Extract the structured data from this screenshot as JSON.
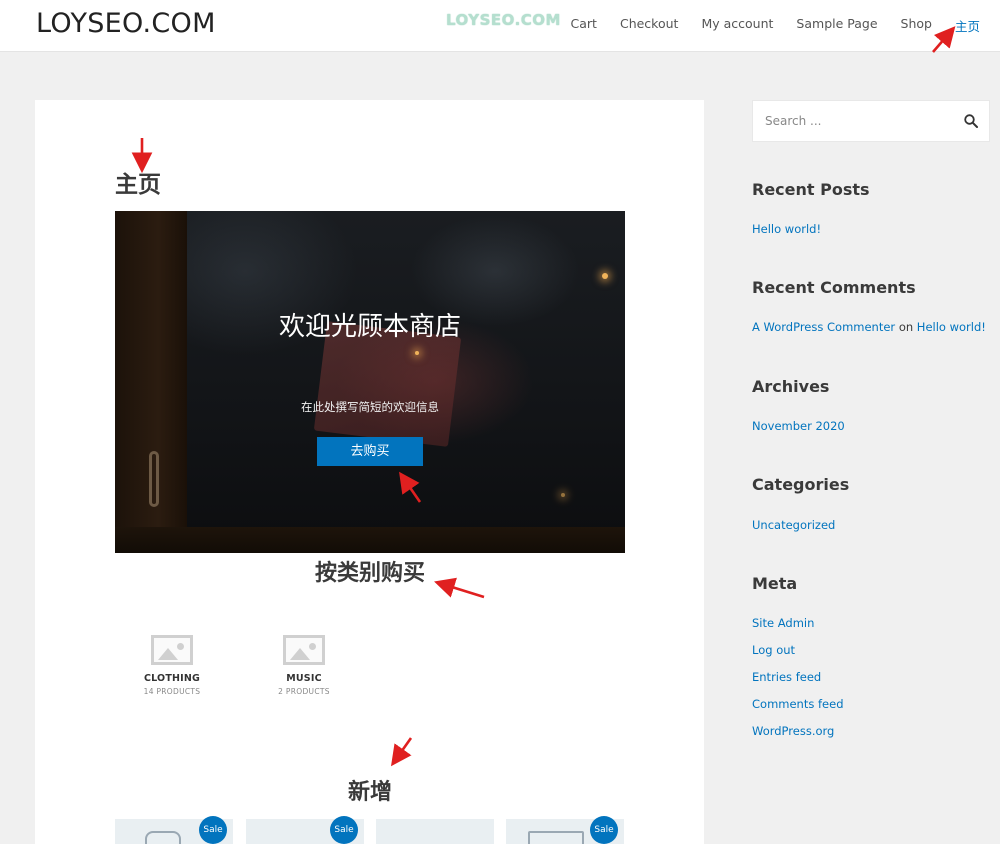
{
  "header": {
    "site_title": "LOYSEO.COM",
    "watermark": "LOYSEO.COM",
    "nav": [
      "Cart",
      "Checkout",
      "My account",
      "Sample Page",
      "Shop",
      "主页"
    ]
  },
  "page": {
    "title": "主页"
  },
  "hero": {
    "headline": "欢迎光顾本商店",
    "subtext": "在此处撰写简短的欢迎信息",
    "button_label": "去购买"
  },
  "categories_section": {
    "title": "按类别购买",
    "items": [
      {
        "name": "CLOTHING",
        "count": "14 PRODUCTS"
      },
      {
        "name": "MUSIC",
        "count": "2 PRODUCTS"
      }
    ]
  },
  "new_section": {
    "title": "新增",
    "badge": "Sale"
  },
  "sidebar": {
    "search_placeholder": "Search ...",
    "recent_posts": {
      "title": "Recent Posts",
      "items": [
        "Hello world!"
      ]
    },
    "recent_comments": {
      "title": "Recent Comments",
      "author": "A WordPress Commenter",
      "on": "on",
      "post": "Hello world!"
    },
    "archives": {
      "title": "Archives",
      "items": [
        "November 2020"
      ]
    },
    "categories": {
      "title": "Categories",
      "items": [
        "Uncategorized"
      ]
    },
    "meta": {
      "title": "Meta",
      "items": [
        "Site Admin",
        "Log out",
        "Entries feed",
        "Comments feed",
        "WordPress.org"
      ]
    }
  },
  "colors": {
    "accent": "#0274be",
    "annotation_arrow": "#e02020"
  }
}
